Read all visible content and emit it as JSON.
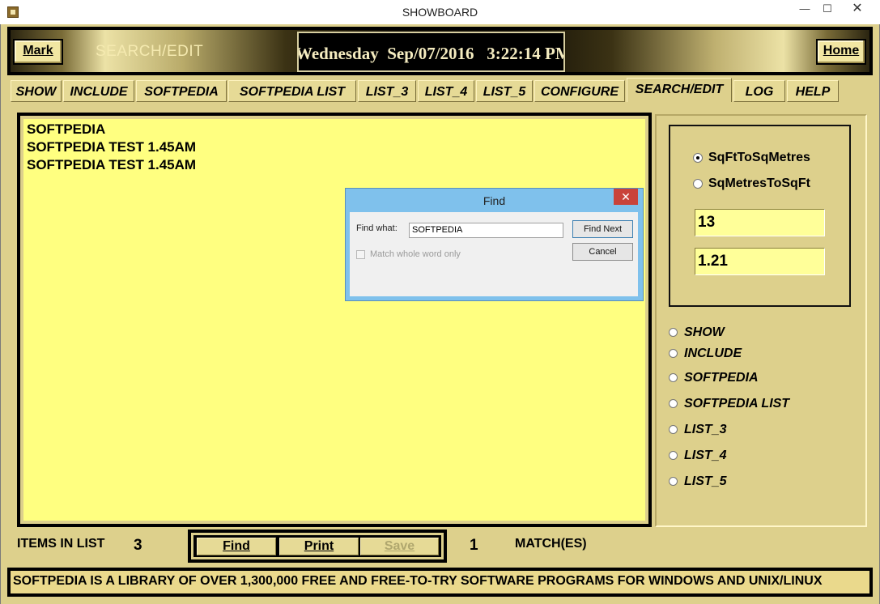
{
  "window": {
    "title": "SHOWBOARD",
    "min": "—",
    "max": "☐",
    "close": "✕"
  },
  "header": {
    "mark_label": "Mark",
    "page_label": "SEARCH/EDIT",
    "home_label": "Home",
    "clock": "Wednesday  Sep/07/2016   3:22:14 PM"
  },
  "tabs": [
    {
      "label": "SHOW"
    },
    {
      "label": "INCLUDE"
    },
    {
      "label": "SOFTPEDIA"
    },
    {
      "label": "SOFTPEDIA LIST"
    },
    {
      "label": "LIST_3"
    },
    {
      "label": "LIST_4"
    },
    {
      "label": "LIST_5"
    },
    {
      "label": "CONFIGURE"
    },
    {
      "label": "SEARCH/EDIT",
      "active": true
    },
    {
      "label": "LOG"
    },
    {
      "label": "HELP"
    }
  ],
  "text_area": {
    "lines": [
      "SOFTPEDIA",
      "SOFTPEDIA TEST 1.45AM",
      "SOFTPEDIA TEST 1.45AM"
    ]
  },
  "converter": {
    "options": [
      {
        "label": "SqFtToSqMetres",
        "selected": true
      },
      {
        "label": "SqMetresToSqFt",
        "selected": false
      }
    ],
    "input_value": "13",
    "output_value": "1.21"
  },
  "list_options": [
    {
      "label": "SHOW"
    },
    {
      "label": "INCLUDE"
    },
    {
      "label": "SOFTPEDIA"
    },
    {
      "label": "SOFTPEDIA LIST"
    },
    {
      "label": "LIST_3"
    },
    {
      "label": "LIST_4"
    },
    {
      "label": "LIST_5"
    }
  ],
  "find_dialog": {
    "title": "Find",
    "find_what_label": "Find what:",
    "find_what_value": "SOFTPEDIA",
    "find_next_label": "Find Next",
    "cancel_label": "Cancel",
    "match_whole_word_label": "Match whole word only",
    "close": "✕"
  },
  "bottom": {
    "items_label": "ITEMS IN LIST",
    "items_count": "3",
    "find_label": "Find",
    "print_label": "Print",
    "save_label": "Save",
    "match_count": "1",
    "match_label": "MATCH(ES)"
  },
  "ticker": {
    "text": "SOFTPEDIA IS A LIBRARY OF OVER 1,300,000 FREE AND FREE-TO-TRY SOFTWARE PROGRAMS FOR WINDOWS AND UNIX/LINUX"
  },
  "colors": {
    "panel": "#ddd08c",
    "text_area": "#ffff80",
    "field": "#ffff99",
    "dialog_accent": "#7fc1ec"
  }
}
